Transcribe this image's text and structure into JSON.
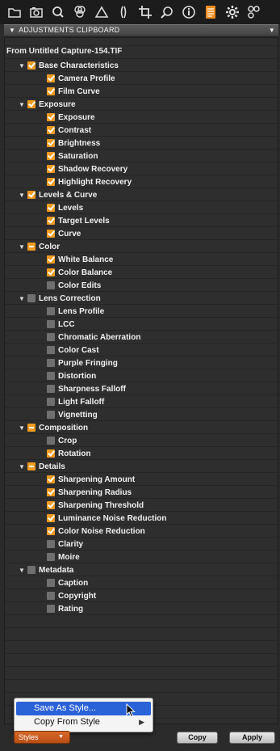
{
  "toolbar": {
    "icons": [
      "folder-icon",
      "camera-icon",
      "search-icon",
      "color-wheel-icon",
      "exposure-icon",
      "lens-icon",
      "crop-icon",
      "spot-icon",
      "info-icon",
      "adjustments-icon",
      "gear-icon",
      "batch-icon"
    ],
    "active_icon": "adjustments-icon",
    "accent_color": "#f08a1d"
  },
  "tool": {
    "title": "ADJUSTMENTS CLIPBOARD",
    "collapse_glyph": "▼",
    "menu_glyph": "▼"
  },
  "source": {
    "title": "From Untitled Capture-154.TIF"
  },
  "groups": [
    {
      "label": "Base Characteristics",
      "state": "checked",
      "items": [
        {
          "label": "Camera Profile",
          "checked": true
        },
        {
          "label": "Film Curve",
          "checked": true
        }
      ]
    },
    {
      "label": "Exposure",
      "state": "checked",
      "items": [
        {
          "label": "Exposure",
          "checked": true
        },
        {
          "label": "Contrast",
          "checked": true
        },
        {
          "label": "Brightness",
          "checked": true
        },
        {
          "label": "Saturation",
          "checked": true
        },
        {
          "label": "Shadow Recovery",
          "checked": true
        },
        {
          "label": "Highlight Recovery",
          "checked": true
        }
      ]
    },
    {
      "label": "Levels & Curve",
      "state": "checked",
      "items": [
        {
          "label": "Levels",
          "checked": true
        },
        {
          "label": "Target Levels",
          "checked": true
        },
        {
          "label": "Curve",
          "checked": true
        }
      ]
    },
    {
      "label": "Color",
      "state": "mixed",
      "items": [
        {
          "label": "White Balance",
          "checked": true
        },
        {
          "label": "Color Balance",
          "checked": true
        },
        {
          "label": "Color Edits",
          "checked": false
        }
      ]
    },
    {
      "label": "Lens Correction",
      "state": "unchecked",
      "items": [
        {
          "label": "Lens Profile",
          "checked": false
        },
        {
          "label": "LCC",
          "checked": false
        },
        {
          "label": "Chromatic Aberration",
          "checked": false
        },
        {
          "label": "Color Cast",
          "checked": false
        },
        {
          "label": "Purple Fringing",
          "checked": false
        },
        {
          "label": "Distortion",
          "checked": false
        },
        {
          "label": "Sharpness Falloff",
          "checked": false
        },
        {
          "label": "Light Falloff",
          "checked": false
        },
        {
          "label": "Vignetting",
          "checked": false
        }
      ]
    },
    {
      "label": "Composition",
      "state": "mixed",
      "items": [
        {
          "label": "Crop",
          "checked": false
        },
        {
          "label": "Rotation",
          "checked": true
        }
      ]
    },
    {
      "label": "Details",
      "state": "mixed",
      "items": [
        {
          "label": "Sharpening Amount",
          "checked": true
        },
        {
          "label": "Sharpening Radius",
          "checked": true
        },
        {
          "label": "Sharpening Threshold",
          "checked": true
        },
        {
          "label": "Luminance Noise Reduction",
          "checked": true
        },
        {
          "label": "Color Noise Reduction",
          "checked": true
        },
        {
          "label": "Clarity",
          "checked": false
        },
        {
          "label": "Moire",
          "checked": false
        }
      ]
    },
    {
      "label": "Metadata",
      "state": "unchecked",
      "items": [
        {
          "label": "Caption",
          "checked": false
        },
        {
          "label": "Copyright",
          "checked": false
        },
        {
          "label": "Rating",
          "checked": false
        }
      ]
    }
  ],
  "popup_menu": {
    "items": [
      {
        "label": "Save As Style...",
        "highlighted": true,
        "submenu": false
      },
      {
        "label": "Copy From Style",
        "highlighted": false,
        "submenu": true
      }
    ],
    "submenu_glyph": "▶"
  },
  "footer": {
    "styles_label": "Styles",
    "styles_arrow": "▼",
    "copy_label": "Copy",
    "apply_label": "Apply"
  }
}
